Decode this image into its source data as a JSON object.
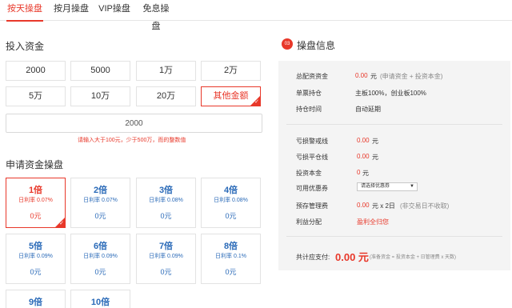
{
  "tabs": [
    {
      "label": "按天操盘",
      "active": true
    },
    {
      "label": "按月操盘",
      "active": false
    },
    {
      "label": "VIP操盘",
      "active": false
    },
    {
      "label": "免息操盘",
      "active": false
    }
  ],
  "invest": {
    "title": "投入资金",
    "amounts": [
      "2000",
      "5000",
      "1万",
      "2万",
      "5万",
      "10万",
      "20万",
      "其他金额"
    ],
    "selected_amount": "其他金额",
    "input_value": "2000",
    "hint": "请输入大于100元，少于500万，而的整数值"
  },
  "apply": {
    "title": "申请资金操盘",
    "multiples": [
      {
        "name": "1倍",
        "rate": "日利率 0.07%",
        "fee": "0元"
      },
      {
        "name": "2倍",
        "rate": "日利率 0.07%",
        "fee": "0元"
      },
      {
        "name": "3倍",
        "rate": "日利率 0.08%",
        "fee": "0元"
      },
      {
        "name": "4倍",
        "rate": "日利率 0.08%",
        "fee": "0元"
      },
      {
        "name": "5倍",
        "rate": "日利率 0.09%",
        "fee": "0元"
      },
      {
        "name": "6倍",
        "rate": "日利率 0.09%",
        "fee": "0元"
      },
      {
        "name": "7倍",
        "rate": "日利率 0.09%",
        "fee": "0元"
      },
      {
        "name": "8倍",
        "rate": "日利率 0.1%",
        "fee": "0元"
      },
      {
        "name": "9倍",
        "rate": "",
        "fee": ""
      },
      {
        "name": "10倍",
        "rate": "",
        "fee": ""
      }
    ],
    "selected_multiple": "1倍"
  },
  "info": {
    "step": "03",
    "title": "操盘信息",
    "total_fund_label": "总配资资金",
    "total_fund_value": "0.00",
    "total_fund_unit": "元",
    "total_fund_note": "(申请资金 + 投资本金)",
    "single_stock_label": "单票持仓",
    "single_stock_value": "主板100%，创业板100%",
    "hold_time_label": "持仓时间",
    "hold_time_value": "自动延期",
    "warn_line_label": "亏损警戒线",
    "warn_line_value": "0.00",
    "warn_line_unit": "元",
    "close_line_label": "亏损平仓线",
    "close_line_value": "0.00",
    "close_line_unit": "元",
    "principal_label": "投资本金",
    "principal_value": "0",
    "principal_unit": "元",
    "coupon_label": "可用优惠券",
    "coupon_selected": "请选择优惠券",
    "fee_label": "预存管理费",
    "fee_value": "0.00",
    "fee_text": "元 x 2日",
    "fee_note": "(非交易日不收取)",
    "profit_label": "利益分配",
    "profit_value": "盈利全归您",
    "total_pay_label": "共计应支付:",
    "total_pay_value": "0.00 元",
    "total_pay_note": "(准备资金 = 投资本金 + 日管理费 x 天数)"
  },
  "colors": {
    "accent": "#e8382a",
    "link": "#2a6ab8",
    "panel_bg": "#f4f4f4"
  }
}
